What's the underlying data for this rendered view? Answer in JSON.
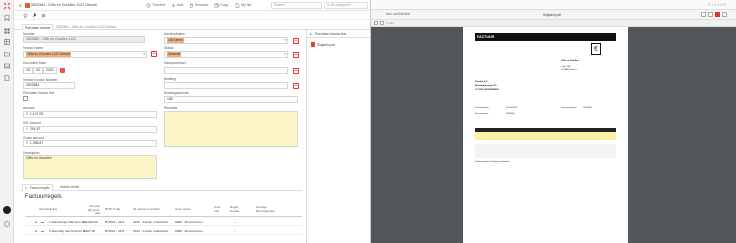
{
  "app": {
    "record_id": "2823384",
    "record_title": "2823384 - Giffo en Goudlen 1122 Utrecht",
    "breadcrumb_current": "2823384 - Giffo en Goudlen 1122 Utrecht"
  },
  "toolbar": {
    "timeline": "Timeline",
    "add": "Add",
    "remove": "Remove",
    "copy": "Copy",
    "my_file": "My file",
    "search_placeholder": "Search",
    "category_placeholder": "In all categories"
  },
  "tabs": [
    {
      "label": "Purchase Invoice"
    }
  ],
  "form": {
    "tabs_label": "Purchase Invoice",
    "fields": {
      "number": {
        "label": "Number",
        "value": "2823384 - Giffo en Goudlen 1122"
      },
      "vendor_name": {
        "label": "Vendor Name",
        "value": "Giffo en Goudlen 1122 Utrecht"
      },
      "document_date": {
        "label": "Document Date",
        "day": "18",
        "month": "03",
        "year": "2022"
      },
      "vendor_invoice_number": {
        "label": "Vendor Invoice Number",
        "value": "2823384"
      },
      "purchase_invoice_line": {
        "label": "Purchase Invoice line"
      },
      "amount": {
        "label": "Amount",
        "prefix": "€",
        "value": "1,107.05"
      },
      "vat_amount": {
        "label": "VAT Amount",
        "prefix": "€",
        "value": "291.87"
      },
      "gross_amount": {
        "label": "Gross amount",
        "prefix": "€",
        "value": "1,398.87"
      },
      "description": {
        "label": "Description",
        "value": "Giffo en Goudlen"
      },
      "administration": {
        "label": "Administration",
        "value": "100 Demo"
      },
      "status": {
        "label": "Status",
        "value": "Verwerkt"
      },
      "inkoopcontract": {
        "label": "Inkoopcontract",
        "value": ""
      },
      "boeking": {
        "label": "Boeking",
        "value": ""
      },
      "boekingsperiode": {
        "label": "Boekingsperiode",
        "value": "185"
      },
      "remarks": {
        "label": "Remarks",
        "value": ""
      }
    }
  },
  "lines_tabs": [
    {
      "label": "2 - Factuurregels"
    },
    {
      "label": "Hidden fields"
    }
  ],
  "factuurregels": {
    "title": "Factuurregels",
    "headers": [
      "Omschrijving",
      "Amount (€) (excl. vat)",
      "BTW Code",
      "GL account number",
      "Cost center",
      "Cost unit",
      "Regel creatie",
      "Overige Bezorgkosten"
    ],
    "rows": [
      {
        "description": "1 Reischeque 500 euro bon...",
        "amount": "€ 1,000.00",
        "btw": "BTW21 - 21%",
        "gl": "0013 - Kosten onderhoud",
        "cost_center": "0908 - Monumenten"
      },
      {
        "description": "1 Recentlly aan M blocs nu...",
        "amount": "€ 107.05",
        "btw": "BTW21 - 21%",
        "gl": "0013 - Kosten onderhoud",
        "cost_center": "0908 - Monumenten"
      }
    ]
  },
  "side_panel": {
    "header": "Purchase Invoice line",
    "attachment": "Sidjadim.pdf"
  },
  "viewer": {
    "brand": "FILEAIRE",
    "tab_label": "Non confidential",
    "file_name": "Sidjadim.pdf",
    "page_label": "1 of 1"
  },
  "invoice_doc": {
    "heading": "FACTUUR",
    "sender_name": "Giffo en Goudlen",
    "sender_line2": "Laan 188",
    "sender_line3": "1234AB  Utrecht",
    "recipient_name": "Fileable B.V.",
    "recipient_street": "Blokkadijkerweg 175",
    "recipient_city": "1711PB ZOETERMEER",
    "meta_left_1": "Factuurdatum:",
    "meta_left_1_val": "18-03-2022",
    "meta_left_2": "Uw referentie:",
    "meta_left_2_val": "2823384",
    "meta_right_1": "Factuurnummer:",
    "meta_right_1_val": "2823384",
    "footer_note": "Gelieve binnen 30 dagen te betalen"
  },
  "colors": {
    "accent_red": "#d33333",
    "field_yellow": "#fbf5c8",
    "tag_orange": "#f0b179"
  }
}
